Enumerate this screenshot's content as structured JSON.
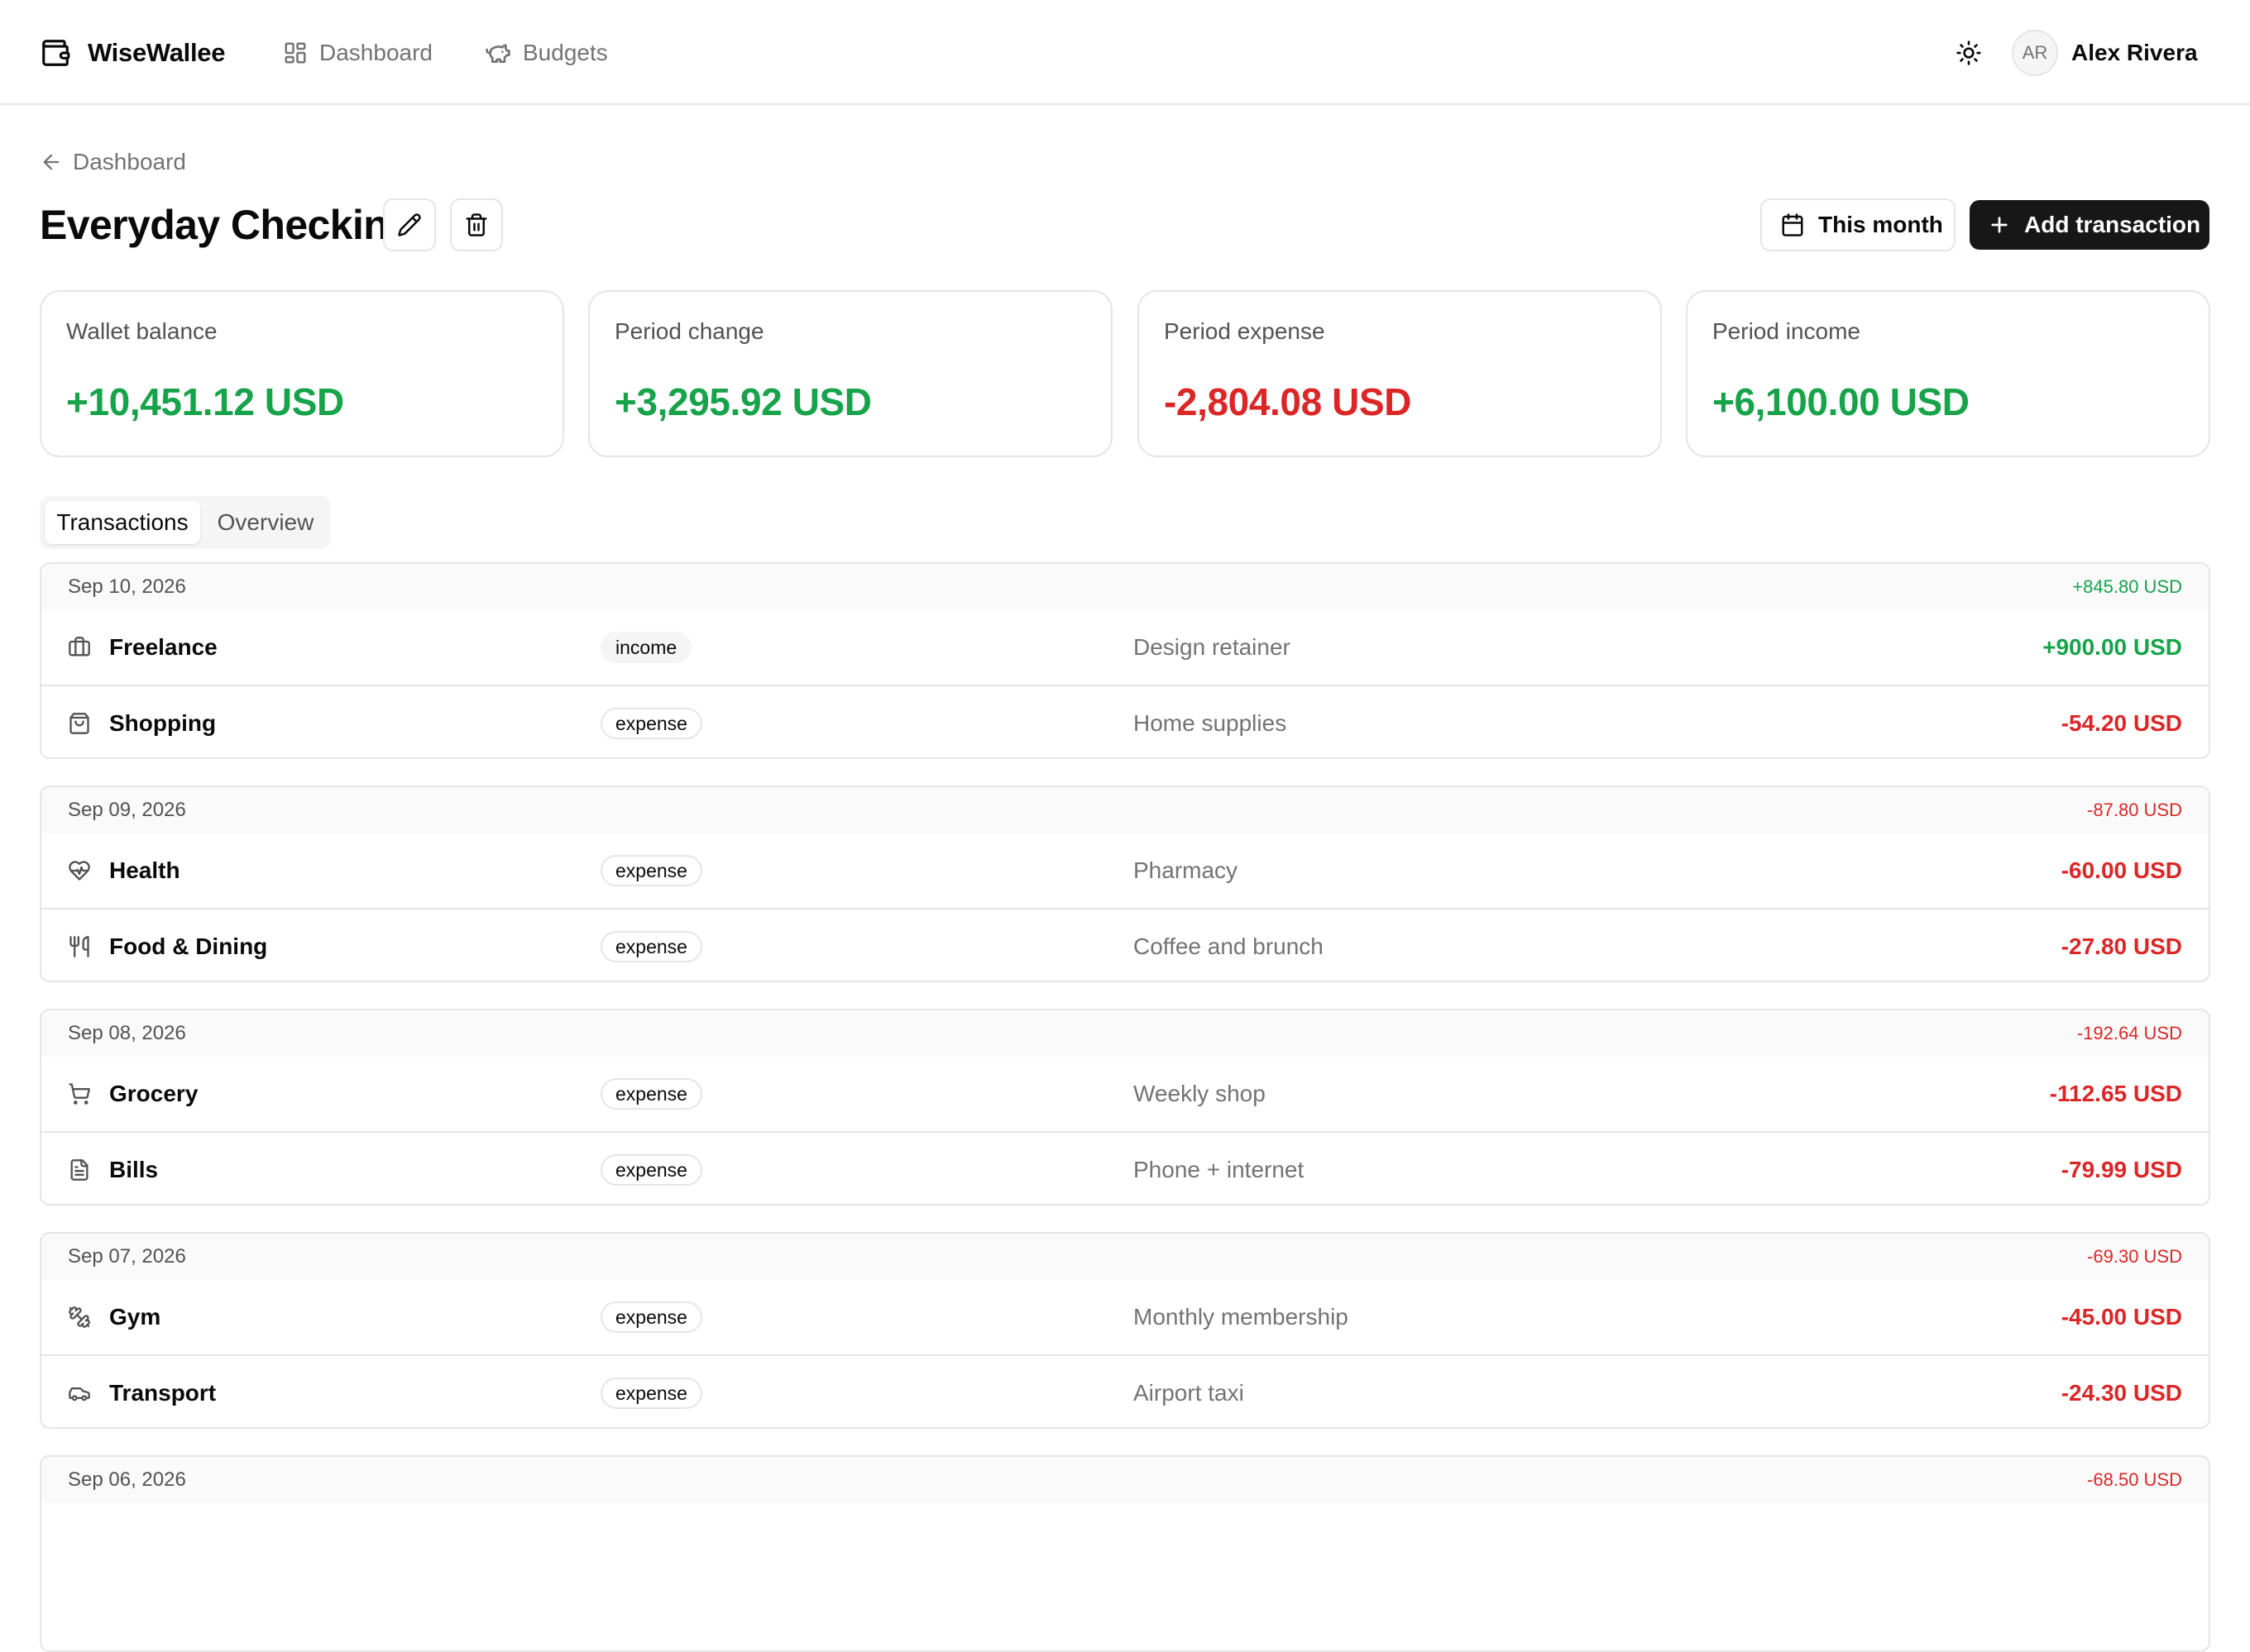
{
  "app": {
    "name": "WiseWallee"
  },
  "nav": {
    "dashboard": "Dashboard",
    "budgets": "Budgets"
  },
  "user": {
    "initials": "AR",
    "name": "Alex Rivera"
  },
  "breadcrumb": {
    "label": "Dashboard"
  },
  "wallet": {
    "title": "Everyday Checking"
  },
  "toolbar": {
    "period_label": "This month",
    "add_label": "Add transaction"
  },
  "stats": {
    "balance": {
      "label": "Wallet balance",
      "value": "+10,451.12 USD"
    },
    "change": {
      "label": "Period change",
      "value": "+3,295.92 USD"
    },
    "expense": {
      "label": "Period expense",
      "value": "-2,804.08 USD"
    },
    "income": {
      "label": "Period income",
      "value": "+6,100.00 USD"
    }
  },
  "tabs": {
    "transactions": "Transactions",
    "overview": "Overview"
  },
  "groups": [
    {
      "date": "Sep 10, 2026",
      "total": "+845.80 USD",
      "rows": [
        {
          "category": "Freelance",
          "icon": "briefcase-icon",
          "type": "income",
          "description": "Design retainer",
          "amount": "+900.00 USD"
        },
        {
          "category": "Shopping",
          "icon": "shopping-bag-icon",
          "type": "expense",
          "description": "Home supplies",
          "amount": "-54.20 USD"
        }
      ]
    },
    {
      "date": "Sep 09, 2026",
      "total": "-87.80 USD",
      "rows": [
        {
          "category": "Health",
          "icon": "heart-pulse-icon",
          "type": "expense",
          "description": "Pharmacy",
          "amount": "-60.00 USD"
        },
        {
          "category": "Food & Dining",
          "icon": "utensils-icon",
          "type": "expense",
          "description": "Coffee and brunch",
          "amount": "-27.80 USD"
        }
      ]
    },
    {
      "date": "Sep 08, 2026",
      "total": "-192.64 USD",
      "rows": [
        {
          "category": "Grocery",
          "icon": "shopping-cart-icon",
          "type": "expense",
          "description": "Weekly shop",
          "amount": "-112.65 USD"
        },
        {
          "category": "Bills",
          "icon": "file-text-icon",
          "type": "expense",
          "description": "Phone + internet",
          "amount": "-79.99 USD"
        }
      ]
    },
    {
      "date": "Sep 07, 2026",
      "total": "-69.30 USD",
      "rows": [
        {
          "category": "Gym",
          "icon": "dumbbell-icon",
          "type": "expense",
          "description": "Monthly membership",
          "amount": "-45.00 USD"
        },
        {
          "category": "Transport",
          "icon": "car-icon",
          "type": "expense",
          "description": "Airport taxi",
          "amount": "-24.30 USD"
        }
      ]
    },
    {
      "date": "Sep 06, 2026",
      "total": "-68.50 USD",
      "rows": []
    }
  ],
  "colors": {
    "positive": "#16a34a",
    "negative": "#dc2626",
    "primary_button": "#171717"
  }
}
